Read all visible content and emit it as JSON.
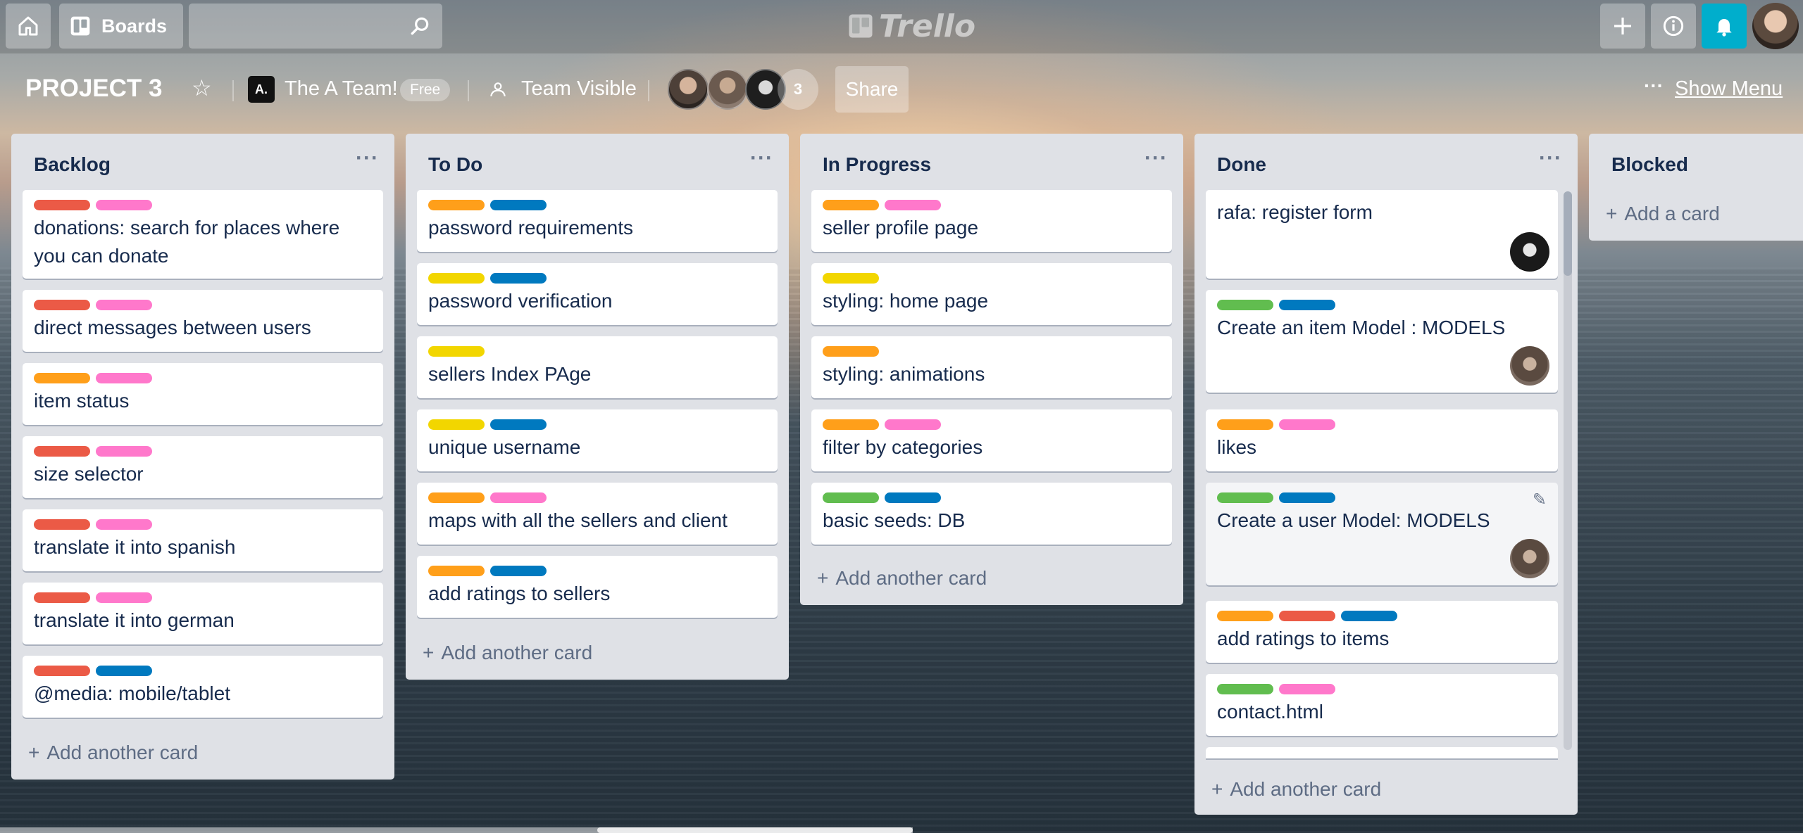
{
  "header": {
    "boards_label": "Boards",
    "search_placeholder": "",
    "logo_text": "Trello"
  },
  "board": {
    "title": "PROJECT 3",
    "team_logo": "A.",
    "team_name": "The A Team!",
    "team_badge": "Free",
    "visibility": "Team Visible",
    "member_count": "3",
    "share_label": "Share",
    "menu_dots": "···",
    "show_menu": "Show Menu"
  },
  "colors": {
    "red": "#eb5a46",
    "pink": "#ff78cb",
    "orange": "#ff9f1a",
    "blue": "#0079bf",
    "yellow": "#f2d600",
    "green": "#61bd4f",
    "notification": "#00aecc",
    "list_bg": "#dfe1e6",
    "card_text": "#172b4d"
  },
  "lists": [
    {
      "title": "Backlog",
      "add_label": "Add another card",
      "cards": [
        {
          "text": "donations: search for places where you can donate",
          "labels": [
            "red",
            "pink"
          ]
        },
        {
          "text": "direct messages between users",
          "labels": [
            "red",
            "pink"
          ]
        },
        {
          "text": "item status",
          "labels": [
            "orange",
            "pink"
          ]
        },
        {
          "text": "size selector",
          "labels": [
            "red",
            "pink"
          ]
        },
        {
          "text": "translate it into spanish",
          "labels": [
            "red",
            "pink"
          ]
        },
        {
          "text": "translate it into german",
          "labels": [
            "red",
            "pink"
          ]
        },
        {
          "text": "@media: mobile/tablet",
          "labels": [
            "red",
            "blue"
          ]
        }
      ]
    },
    {
      "title": "To Do",
      "add_label": "Add another card",
      "cards": [
        {
          "text": "password requirements",
          "labels": [
            "orange",
            "blue"
          ]
        },
        {
          "text": "password verification",
          "labels": [
            "yellow",
            "blue"
          ]
        },
        {
          "text": "sellers Index PAge",
          "labels": [
            "yellow"
          ]
        },
        {
          "text": "unique username",
          "labels": [
            "yellow",
            "blue"
          ]
        },
        {
          "text": "maps with all the sellers and client",
          "labels": [
            "orange",
            "pink"
          ]
        },
        {
          "text": "add ratings to sellers",
          "labels": [
            "orange",
            "blue"
          ]
        }
      ]
    },
    {
      "title": "In Progress",
      "add_label": "Add another card",
      "cards": [
        {
          "text": "seller profile page",
          "labels": [
            "orange",
            "pink"
          ]
        },
        {
          "text": "styling: home page",
          "labels": [
            "yellow"
          ]
        },
        {
          "text": "styling: animations",
          "labels": [
            "orange"
          ]
        },
        {
          "text": "filter by categories",
          "labels": [
            "orange",
            "pink"
          ]
        },
        {
          "text": "basic seeds: DB",
          "labels": [
            "green",
            "blue"
          ]
        }
      ]
    },
    {
      "title": "Done",
      "add_label": "Add another card",
      "cards": [
        {
          "text": "rafa: register form",
          "labels": []
        },
        {
          "text": "Create an item Model : MODELS",
          "labels": [
            "green",
            "blue"
          ]
        },
        {
          "text": "likes",
          "labels": [
            "orange",
            "pink"
          ]
        },
        {
          "text": "Create a user Model: MODELS",
          "labels": [
            "green",
            "blue"
          ]
        },
        {
          "text": "add ratings to items",
          "labels": [
            "orange",
            "red",
            "blue"
          ]
        },
        {
          "text": "contact.html",
          "labels": [
            "green",
            "pink"
          ]
        }
      ]
    },
    {
      "title": "Blocked",
      "add_label": "Add a card",
      "cards": []
    }
  ]
}
